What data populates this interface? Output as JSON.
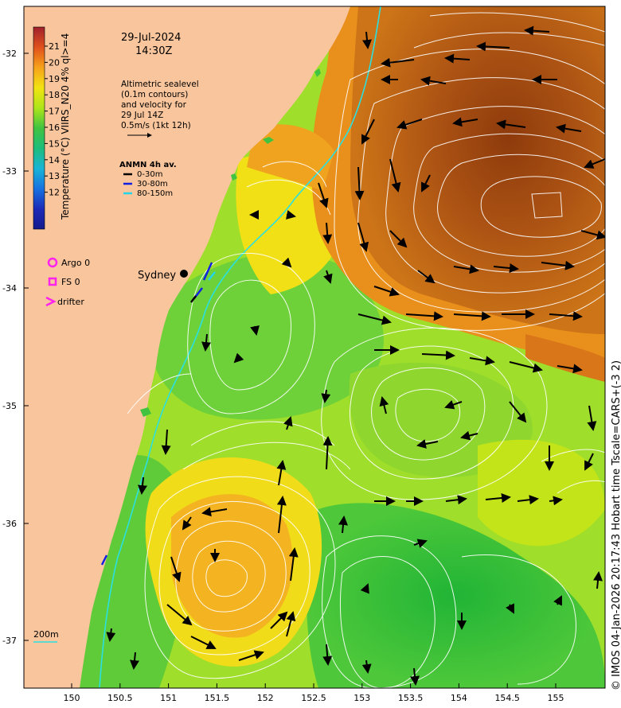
{
  "header": {
    "date": "29-Jul-2024",
    "time": "14:30Z"
  },
  "colorbar": {
    "label": "Temperature (°C) VIIRS_N20 4% ql>=4",
    "ticks": [
      "21",
      "20",
      "19",
      "18",
      "17",
      "16",
      "15",
      "14",
      "13",
      "12"
    ],
    "colors": [
      "#a0202c",
      "#e0501c",
      "#f7a21a",
      "#f2e312",
      "#aee51a",
      "#41c341",
      "#1cbd7b",
      "#18b4d6",
      "#1672e0",
      "#1c2ab8",
      "#141a8c"
    ]
  },
  "altimetry": {
    "lines": [
      "Altimetric sealevel",
      "(0.1m contours)",
      "and velocity for",
      "29 Jul 14Z",
      "0.5m/s (1kt 12h)"
    ]
  },
  "anmn": {
    "title": "ANMN 4h av.",
    "items": [
      {
        "label": "0-30m",
        "color": "#000000"
      },
      {
        "label": "30-80m",
        "color": "#1020e0"
      },
      {
        "label": "80-150m",
        "color": "#21d6e8"
      }
    ]
  },
  "legend": {
    "argo": "Argo 0",
    "fs": "FS 0",
    "drifter": "drifter",
    "marker_color": "#ff22ee"
  },
  "city": "Sydney",
  "isobath": "200m",
  "axes": {
    "lat_ticks": [
      "-32",
      "-33",
      "-34",
      "-35",
      "-36",
      "-37"
    ],
    "lon_ticks": [
      "150",
      "150.5",
      "151",
      "151.5",
      "152",
      "152.5",
      "153",
      "153.5",
      "154",
      "154.5",
      "155"
    ]
  },
  "credit": "© IMOS 04-Jan-2026 20:17:43 Hobart time Tscale=CARS+(-3 2)",
  "colors": {
    "land": "#f9c59c",
    "warm_core": "#a54a12",
    "shelf_water": "#42c23a",
    "isobath_line": "#2be0e0"
  }
}
